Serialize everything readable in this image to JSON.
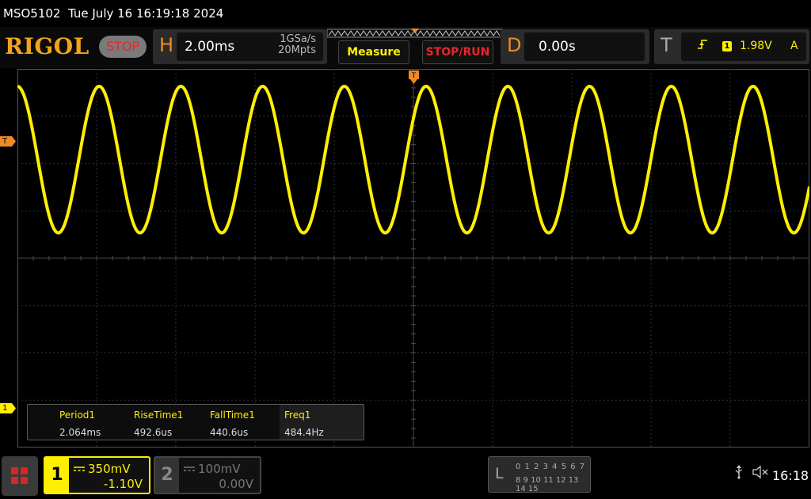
{
  "title_bar": {
    "model": "MSO5102",
    "datetime": "Tue July 16 16:19:18 2024"
  },
  "top": {
    "logo": "RIGOL",
    "status": "STOP",
    "horizontal": {
      "letter": "H",
      "timebase": "2.00ms",
      "sample_rate": "1GSa/s",
      "memory_depth": "20Mpts"
    },
    "measure_button": "Measure",
    "stoprun_button": "STOP/RUN",
    "delay": {
      "letter": "D",
      "value": "0.00s"
    },
    "trigger": {
      "letter": "T",
      "slope_icon": "rising-edge-icon",
      "source": "1",
      "level": "1.98V",
      "mode": "A"
    }
  },
  "screen": {
    "trigger_marker": "T",
    "ch1_marker": "1",
    "trace_color": "#ffef00"
  },
  "measurements": {
    "headers": [
      "Period1",
      "RiseTime1",
      "FallTime1",
      "Freq1"
    ],
    "values": [
      "2.064ms",
      "492.6us",
      "440.6us",
      "484.4Hz"
    ]
  },
  "bottom": {
    "ch1": {
      "num": "1",
      "scale": "350mV",
      "offset": "-1.10V"
    },
    "ch2": {
      "num": "2",
      "scale": "100mV",
      "offset": "0.00V"
    },
    "logic": {
      "letter": "L",
      "row1": "0 1 2 3  4 5 6 7",
      "row2": "8 9 10 11 12 13 14 15"
    },
    "usb_icon": "usb-icon",
    "volume_icon": "mute-icon",
    "clock": "16:18"
  }
}
